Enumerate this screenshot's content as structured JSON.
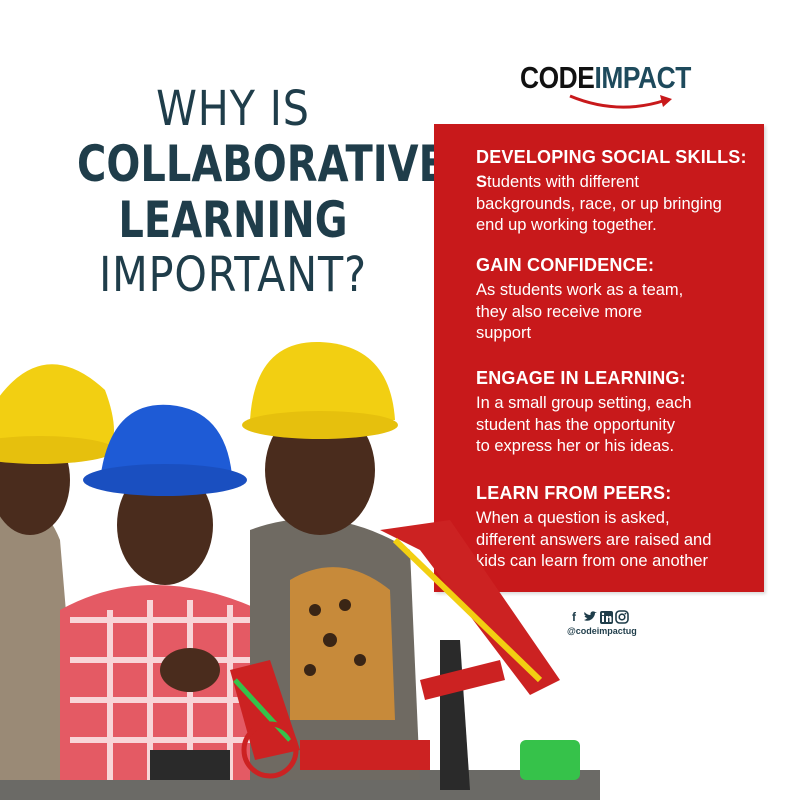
{
  "headline": {
    "line1": "WHY IS",
    "line2": "COLLABORATIVE",
    "line3": "LEARNING",
    "line4": "IMPORTANT?"
  },
  "logo": {
    "part1": "CODE",
    "part2": "IMPACT"
  },
  "sections": [
    {
      "title": "DEVELOPING SOCIAL SKILLS:",
      "first_letter": "S",
      "body": "tudents with different\nbackgrounds, race, or up bringing\nend up working  together."
    },
    {
      "title": "GAIN CONFIDENCE:",
      "body": "As students work as a team,\nthey also receive more\nsupport"
    },
    {
      "title": "ENGAGE IN LEARNING:",
      "body": "In a small group setting, each\nstudent has the opportunity\nto express her or his ideas."
    },
    {
      "title": "LEARN FROM PEERS:",
      "body": "When a question is asked,\ndifferent answers are raised and\nkids can learn  from one another"
    }
  ],
  "social": {
    "handle": "@codeimpactug",
    "icons": [
      "facebook-icon",
      "twitter-icon",
      "linkedin-icon",
      "instagram-icon"
    ]
  },
  "colors": {
    "panel": "#c8191b",
    "headline": "#1f3d4a",
    "hat_yellow": "#f2cf12",
    "hat_blue": "#1e5bd6"
  }
}
